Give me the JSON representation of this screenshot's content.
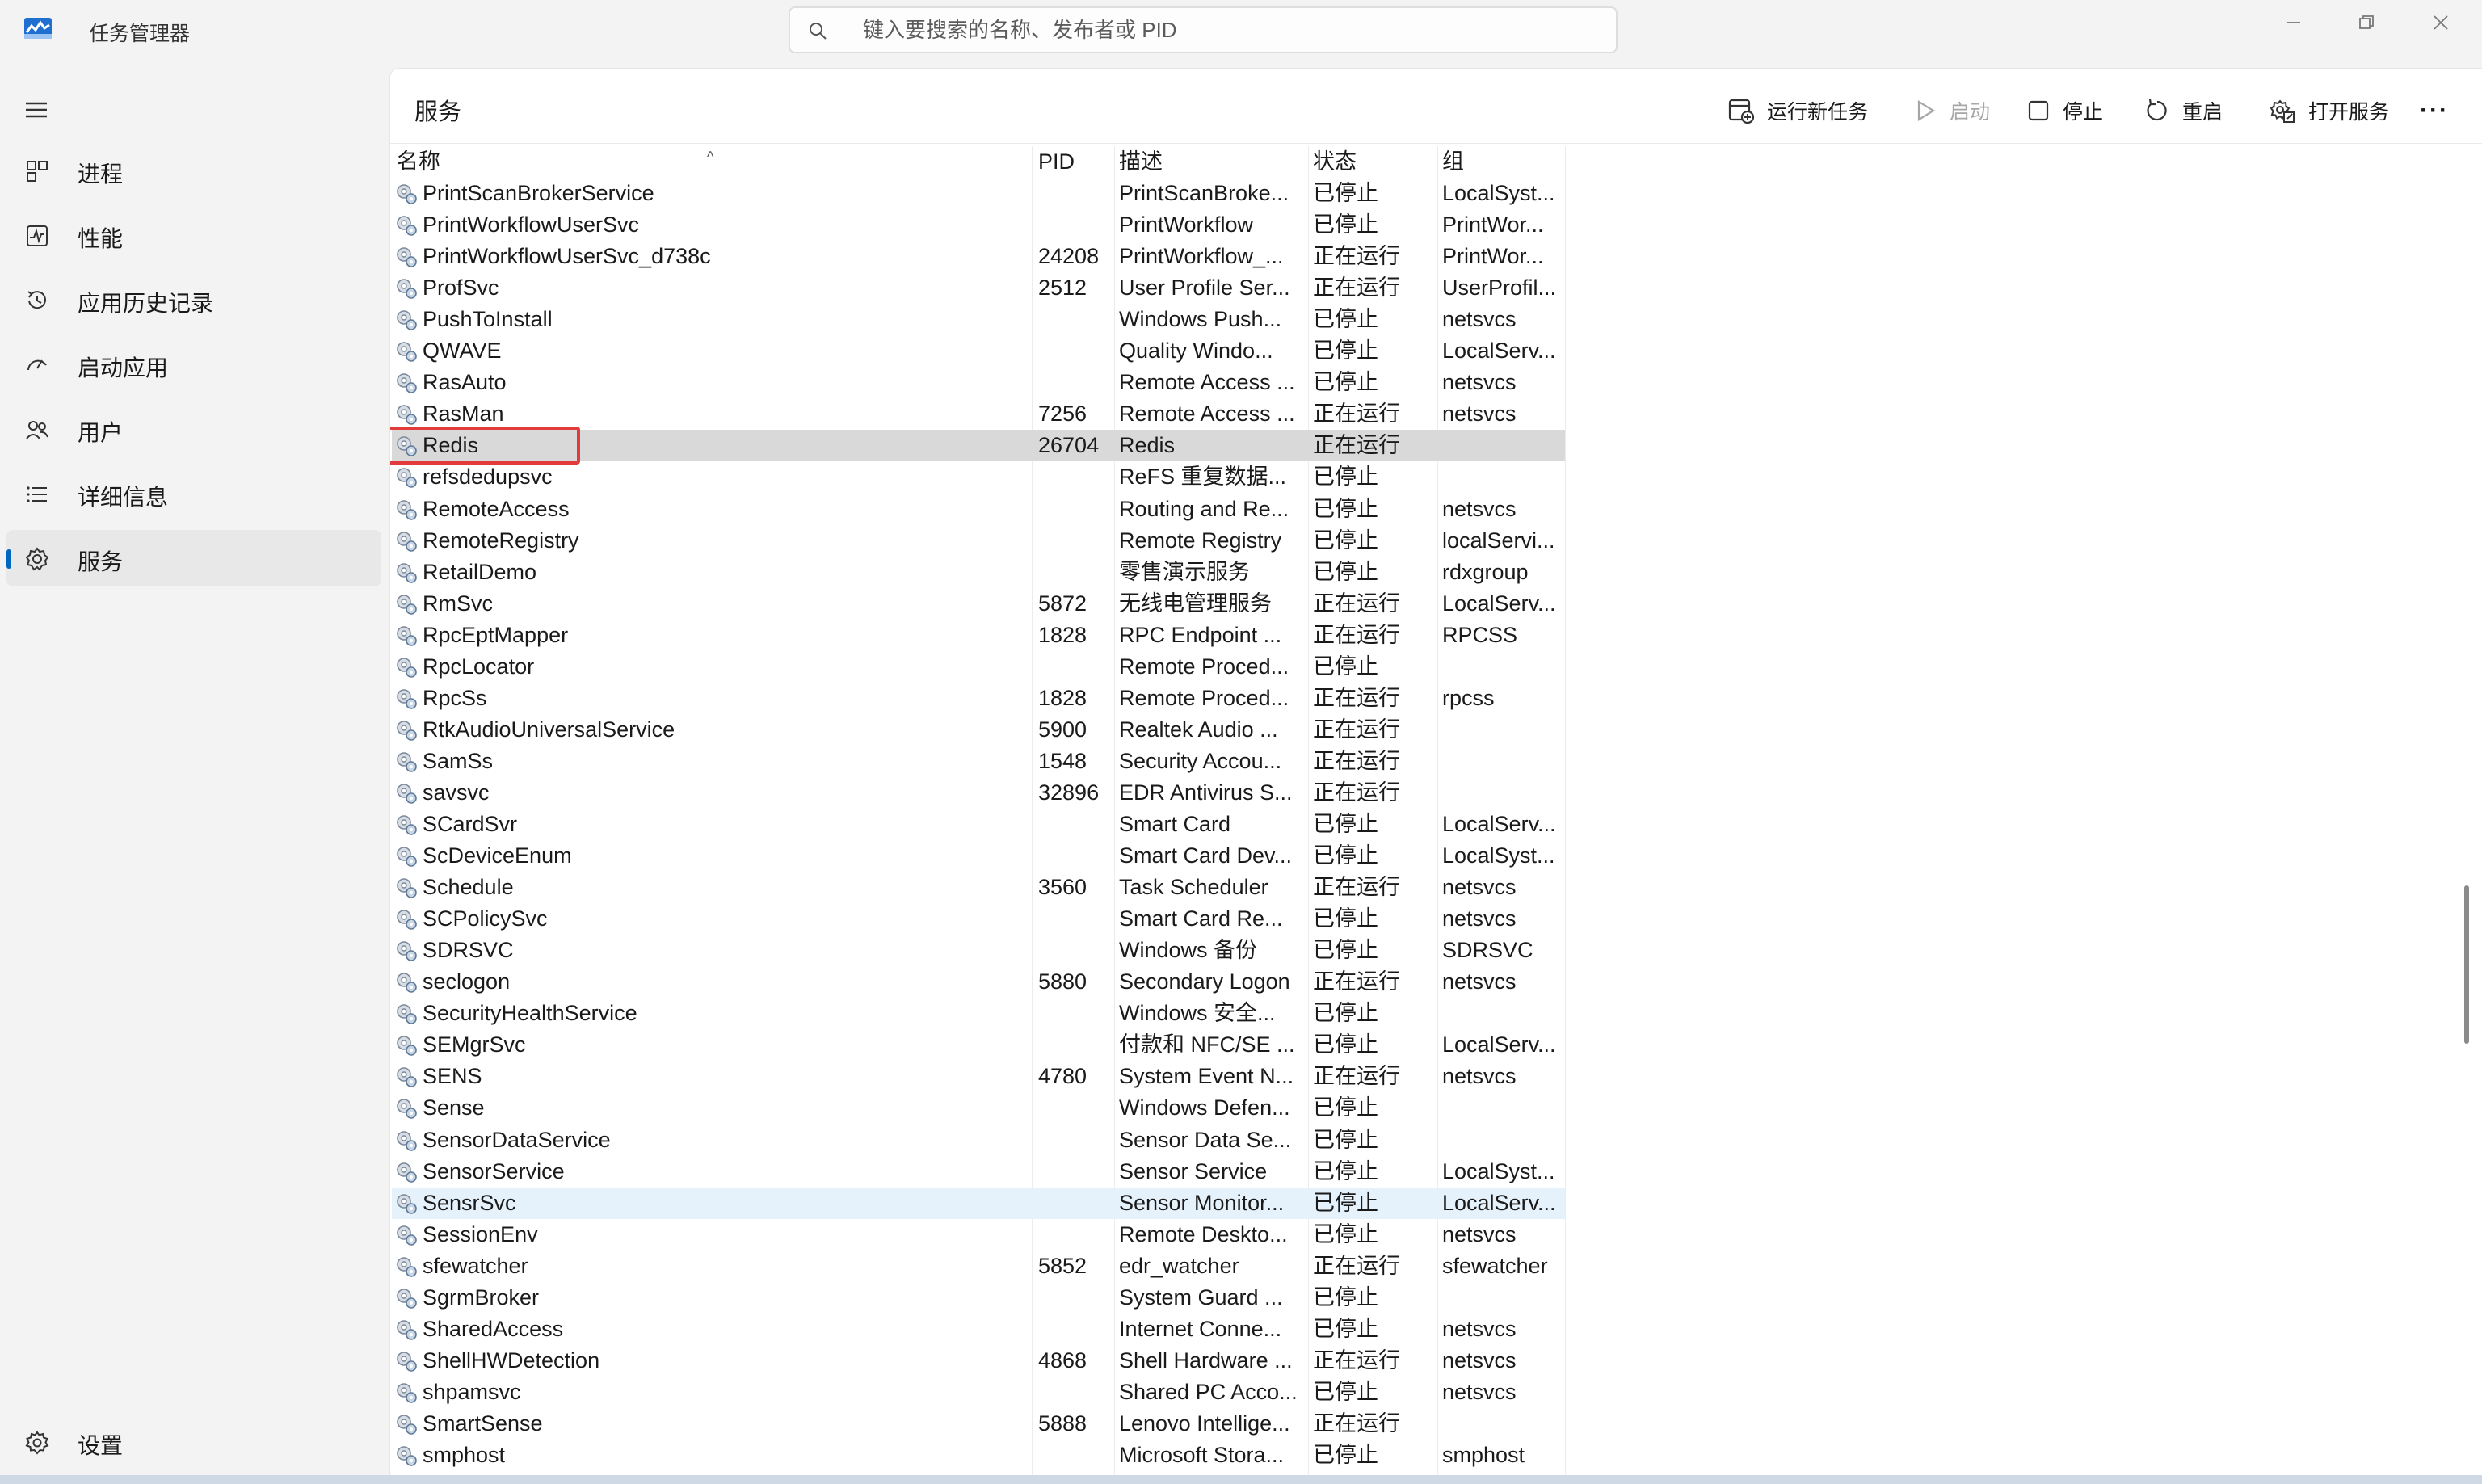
{
  "window": {
    "title": "任务管理器",
    "controls": [
      "minimize",
      "restore",
      "close"
    ]
  },
  "search": {
    "placeholder": "键入要搜索的名称、发布者或 PID",
    "value": ""
  },
  "sidebar": {
    "items": [
      {
        "label": "进程",
        "icon": "processes-icon",
        "active": false
      },
      {
        "label": "性能",
        "icon": "performance-icon",
        "active": false
      },
      {
        "label": "应用历史记录",
        "icon": "app-history-icon",
        "active": false
      },
      {
        "label": "启动应用",
        "icon": "startup-apps-icon",
        "active": false
      },
      {
        "label": "用户",
        "icon": "users-icon",
        "active": false
      },
      {
        "label": "详细信息",
        "icon": "details-icon",
        "active": false
      },
      {
        "label": "服务",
        "icon": "services-icon",
        "active": true
      }
    ],
    "settings_label": "设置"
  },
  "main": {
    "title": "服务",
    "toolbar": {
      "run_new_task": "运行新任务",
      "start": "启动",
      "stop": "停止",
      "restart": "重启",
      "open_services": "打开服务",
      "more": "···"
    }
  },
  "table": {
    "sort_indicator": "^",
    "headers": {
      "name": "名称",
      "pid": "PID",
      "desc": "描述",
      "status": "状态",
      "group": "组"
    },
    "rows": [
      {
        "name": "PrintScanBrokerService",
        "pid": "",
        "desc": "PrintScanBroke...",
        "status": "已停止",
        "group": "LocalSyst..."
      },
      {
        "name": "PrintWorkflowUserSvc",
        "pid": "",
        "desc": "PrintWorkflow",
        "status": "已停止",
        "group": "PrintWor..."
      },
      {
        "name": "PrintWorkflowUserSvc_d738c",
        "pid": "24208",
        "desc": "PrintWorkflow_...",
        "status": "正在运行",
        "group": "PrintWor..."
      },
      {
        "name": "ProfSvc",
        "pid": "2512",
        "desc": "User Profile Ser...",
        "status": "正在运行",
        "group": "UserProfil..."
      },
      {
        "name": "PushToInstall",
        "pid": "",
        "desc": "Windows Push...",
        "status": "已停止",
        "group": "netsvcs"
      },
      {
        "name": "QWAVE",
        "pid": "",
        "desc": "Quality Windo...",
        "status": "已停止",
        "group": "LocalServ..."
      },
      {
        "name": "RasAuto",
        "pid": "",
        "desc": "Remote Access ...",
        "status": "已停止",
        "group": "netsvcs"
      },
      {
        "name": "RasMan",
        "pid": "7256",
        "desc": "Remote Access ...",
        "status": "正在运行",
        "group": "netsvcs"
      },
      {
        "name": "Redis",
        "pid": "26704",
        "desc": "Redis",
        "status": "正在运行",
        "group": "",
        "highlight": "gray",
        "boxed": true
      },
      {
        "name": "refsdedupsvc",
        "pid": "",
        "desc": "ReFS 重复数据...",
        "status": "已停止",
        "group": ""
      },
      {
        "name": "RemoteAccess",
        "pid": "",
        "desc": "Routing and Re...",
        "status": "已停止",
        "group": "netsvcs"
      },
      {
        "name": "RemoteRegistry",
        "pid": "",
        "desc": "Remote Registry",
        "status": "已停止",
        "group": "localServi..."
      },
      {
        "name": "RetailDemo",
        "pid": "",
        "desc": "零售演示服务",
        "status": "已停止",
        "group": "rdxgroup"
      },
      {
        "name": "RmSvc",
        "pid": "5872",
        "desc": "无线电管理服务",
        "status": "正在运行",
        "group": "LocalServ..."
      },
      {
        "name": "RpcEptMapper",
        "pid": "1828",
        "desc": "RPC Endpoint ...",
        "status": "正在运行",
        "group": "RPCSS"
      },
      {
        "name": "RpcLocator",
        "pid": "",
        "desc": "Remote Proced...",
        "status": "已停止",
        "group": ""
      },
      {
        "name": "RpcSs",
        "pid": "1828",
        "desc": "Remote Proced...",
        "status": "正在运行",
        "group": "rpcss"
      },
      {
        "name": "RtkAudioUniversalService",
        "pid": "5900",
        "desc": "Realtek Audio ...",
        "status": "正在运行",
        "group": ""
      },
      {
        "name": "SamSs",
        "pid": "1548",
        "desc": "Security Accou...",
        "status": "正在运行",
        "group": ""
      },
      {
        "name": "savsvc",
        "pid": "32896",
        "desc": "EDR Antivirus S...",
        "status": "正在运行",
        "group": ""
      },
      {
        "name": "SCardSvr",
        "pid": "",
        "desc": "Smart Card",
        "status": "已停止",
        "group": "LocalServ..."
      },
      {
        "name": "ScDeviceEnum",
        "pid": "",
        "desc": "Smart Card Dev...",
        "status": "已停止",
        "group": "LocalSyst..."
      },
      {
        "name": "Schedule",
        "pid": "3560",
        "desc": "Task Scheduler",
        "status": "正在运行",
        "group": "netsvcs"
      },
      {
        "name": "SCPolicySvc",
        "pid": "",
        "desc": "Smart Card Re...",
        "status": "已停止",
        "group": "netsvcs"
      },
      {
        "name": "SDRSVC",
        "pid": "",
        "desc": "Windows 备份",
        "status": "已停止",
        "group": "SDRSVC"
      },
      {
        "name": "seclogon",
        "pid": "5880",
        "desc": "Secondary Logon",
        "status": "正在运行",
        "group": "netsvcs"
      },
      {
        "name": "SecurityHealthService",
        "pid": "",
        "desc": "Windows 安全...",
        "status": "已停止",
        "group": ""
      },
      {
        "name": "SEMgrSvc",
        "pid": "",
        "desc": "付款和 NFC/SE ...",
        "status": "已停止",
        "group": "LocalServ..."
      },
      {
        "name": "SENS",
        "pid": "4780",
        "desc": "System Event N...",
        "status": "正在运行",
        "group": "netsvcs"
      },
      {
        "name": "Sense",
        "pid": "",
        "desc": "Windows Defen...",
        "status": "已停止",
        "group": ""
      },
      {
        "name": "SensorDataService",
        "pid": "",
        "desc": "Sensor Data Se...",
        "status": "已停止",
        "group": ""
      },
      {
        "name": "SensorService",
        "pid": "",
        "desc": "Sensor Service",
        "status": "已停止",
        "group": "LocalSyst..."
      },
      {
        "name": "SensrSvc",
        "pid": "",
        "desc": "Sensor Monitor...",
        "status": "已停止",
        "group": "LocalServ...",
        "highlight": "blue"
      },
      {
        "name": "SessionEnv",
        "pid": "",
        "desc": "Remote Deskto...",
        "status": "已停止",
        "group": "netsvcs"
      },
      {
        "name": "sfewatcher",
        "pid": "5852",
        "desc": "edr_watcher",
        "status": "正在运行",
        "group": "sfewatcher"
      },
      {
        "name": "SgrmBroker",
        "pid": "",
        "desc": "System Guard ...",
        "status": "已停止",
        "group": ""
      },
      {
        "name": "SharedAccess",
        "pid": "",
        "desc": "Internet Conne...",
        "status": "已停止",
        "group": "netsvcs"
      },
      {
        "name": "ShellHWDetection",
        "pid": "4868",
        "desc": "Shell Hardware ...",
        "status": "正在运行",
        "group": "netsvcs"
      },
      {
        "name": "shpamsvc",
        "pid": "",
        "desc": "Shared PC Acco...",
        "status": "已停止",
        "group": "netsvcs"
      },
      {
        "name": "SmartSense",
        "pid": "5888",
        "desc": "Lenovo Intellige...",
        "status": "正在运行",
        "group": ""
      },
      {
        "name": "smphost",
        "pid": "",
        "desc": "Microsoft Stora...",
        "status": "已停止",
        "group": "smphost"
      }
    ]
  },
  "colors": {
    "accent": "#0067c0",
    "highlight_box": "#e23b3b",
    "selected_row": "#d9d9d9",
    "hover_row": "#e5f1fb"
  }
}
